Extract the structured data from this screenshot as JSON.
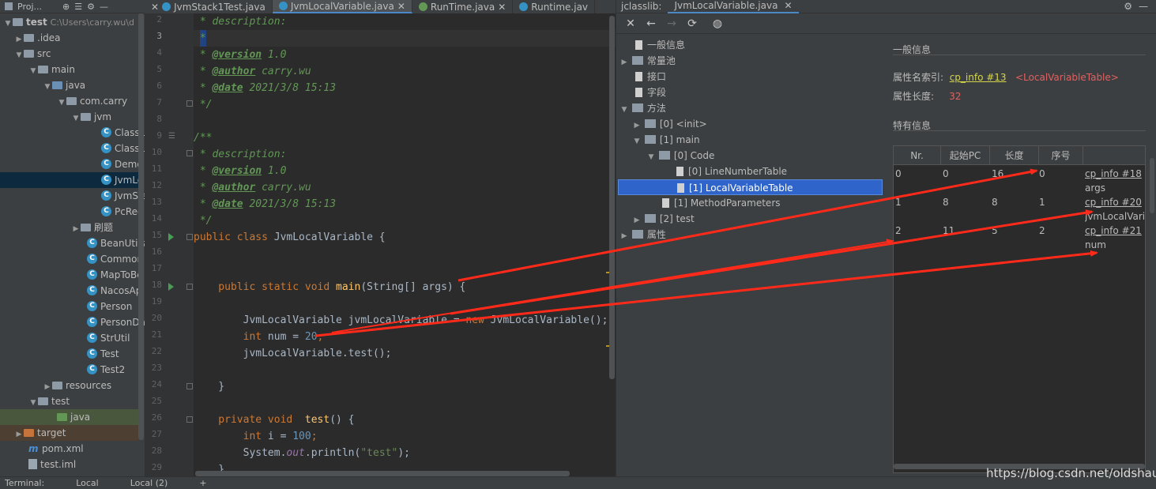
{
  "project": {
    "header_label": "Proj...",
    "root_name": "test",
    "root_path": "C:\\Users\\carry.wu\\d",
    "items": [
      {
        "label": ".idea"
      },
      {
        "label": "src"
      },
      {
        "label": "main"
      },
      {
        "label": "java"
      },
      {
        "label": "com.carry"
      },
      {
        "label": "jvm"
      },
      {
        "label": "ClassL"
      },
      {
        "label": "ClassL"
      },
      {
        "label": "Demo"
      },
      {
        "label": "JvmLo"
      },
      {
        "label": "JvmSta"
      },
      {
        "label": "PcReg"
      },
      {
        "label": "刷题"
      },
      {
        "label": "BeanUtils"
      },
      {
        "label": "Common"
      },
      {
        "label": "MapToBe"
      },
      {
        "label": "NacosAp"
      },
      {
        "label": "Person"
      },
      {
        "label": "PersonDa"
      },
      {
        "label": "StrUtil"
      },
      {
        "label": "Test"
      },
      {
        "label": "Test2"
      },
      {
        "label": "resources"
      },
      {
        "label": "test"
      },
      {
        "label": "java"
      },
      {
        "label": "target"
      },
      {
        "label": "pom.xml"
      },
      {
        "label": "test.iml"
      }
    ]
  },
  "editor": {
    "tabs": [
      {
        "label": "JvmStack1Test.java"
      },
      {
        "label": "JvmLocalVariable.java"
      },
      {
        "label": "RunTime.java"
      },
      {
        "label": "Runtime.jav"
      }
    ],
    "line_numbers": [
      "2",
      "3",
      "4",
      "5",
      "6",
      "7",
      "8",
      "9",
      "10",
      "11",
      "12",
      "13",
      "14",
      "15",
      "16",
      "17",
      "18",
      "19",
      "20",
      "21",
      "22",
      "23",
      "24",
      "25",
      "26",
      "27",
      "28",
      "29"
    ],
    "code": {
      "l2": " * description:",
      "l3": "*",
      "l4a": " * ",
      "l4t": "@version",
      "l4b": " 1.0",
      "l5a": " * ",
      "l5t": "@author",
      "l5b": " carry.wu",
      "l6a": " * ",
      "l6t": "@date",
      "l6b": " 2021/3/8 15:13",
      "l7": " */",
      "l9": "/**",
      "l10": " * description:",
      "l11a": " * ",
      "l11t": "@version",
      "l11b": " 1.0",
      "l12a": " * ",
      "l12t": "@author",
      "l12b": " carry.wu",
      "l13a": " * ",
      "l13t": "@date",
      "l13b": " 2021/3/8 15:13",
      "l14": " */",
      "l15k": "public class ",
      "l15n": "JvmLocalVariable {",
      "l18k": "    public static void ",
      "l18f": "main",
      "l18r": "(String[] args) {",
      "l20a": "        JvmLocalVariable jvmLocalVariable = ",
      "l20k": "new",
      "l20b": " JvmLocalVariable();",
      "l21k": "        int",
      "l21a": " num = ",
      "l21n": "20",
      "l21b": ";",
      "l22": "        jvmLocalVariable.test();",
      "l24": "    }",
      "l26k": "    private void  ",
      "l26f": "test",
      "l26r": "() {",
      "l27k": "        int",
      "l27a": " i = ",
      "l27n": "100",
      "l27b": ";",
      "l28a": "        System.",
      "l28s": "out",
      "l28b": ".println(",
      "l28str": "\"test\"",
      "l28c": ");",
      "l29": "    }"
    }
  },
  "jclasslib": {
    "tab_prefix": "jclasslib:",
    "tab_file": "JvmLocalVariable.java",
    "tree": [
      {
        "label": "一般信息"
      },
      {
        "label": "常量池"
      },
      {
        "label": "接口"
      },
      {
        "label": "字段"
      },
      {
        "label": "方法"
      },
      {
        "label": "[0] <init>"
      },
      {
        "label": "[1] main"
      },
      {
        "label": "[0] Code"
      },
      {
        "label": "[0] LineNumberTable"
      },
      {
        "label": "[1] LocalVariableTable"
      },
      {
        "label": "[1] MethodParameters"
      },
      {
        "label": "[2] test"
      },
      {
        "label": "属性"
      }
    ],
    "general_title": "一般信息",
    "attr_name_label": "属性名索引:",
    "attr_name_link": "cp_info #13",
    "attr_name_value": "<LocalVariableTable>",
    "attr_len_label": "属性长度:",
    "attr_len_value": "32",
    "specific_title": "特有信息",
    "table": {
      "headers": [
        "Nr.",
        "起始PC",
        "长度",
        "序号",
        ""
      ],
      "rows": [
        {
          "nr": "0",
          "pc": "0",
          "len": "16",
          "idx": "0",
          "link": "cp_info #18",
          "name": "args"
        },
        {
          "nr": "1",
          "pc": "8",
          "len": "8",
          "idx": "1",
          "link": "cp_info #20",
          "name": "jvmLocalVaria"
        },
        {
          "nr": "2",
          "pc": "11",
          "len": "5",
          "idx": "2",
          "link": "cp_info #21",
          "name": "num"
        }
      ]
    }
  },
  "bottom": {
    "items": [
      {
        "label": "Terminal:"
      },
      {
        "label": "Local"
      },
      {
        "label": "Local (2)"
      }
    ]
  },
  "watermark": "https://blog.csdn.net/oldshaui",
  "colors": {
    "arrow": "#ff2a1a",
    "link": "#d6d64a",
    "accent_red": "#e06060"
  }
}
